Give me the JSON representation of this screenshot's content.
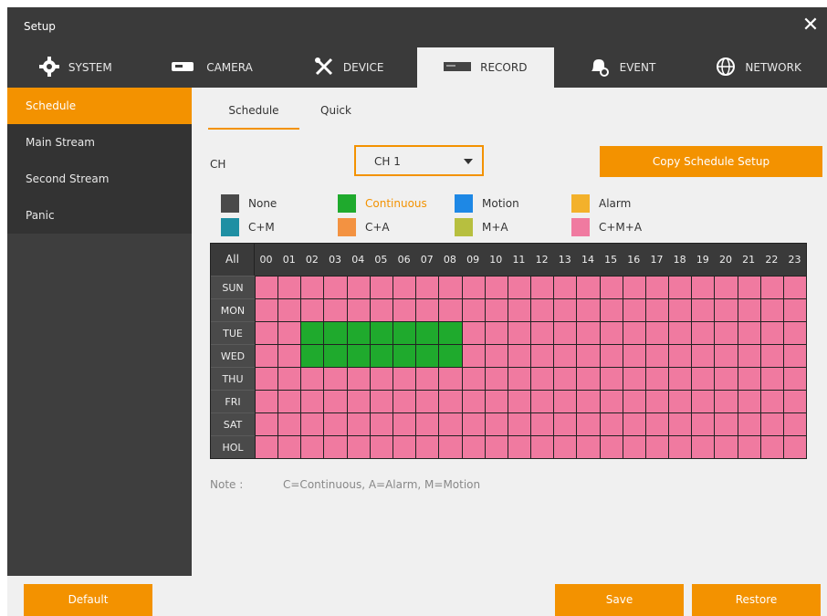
{
  "window": {
    "title": "Setup"
  },
  "tabs": [
    {
      "label": "SYSTEM",
      "icon": "gear-icon",
      "active": false
    },
    {
      "label": "CAMERA",
      "icon": "camera-icon",
      "active": false
    },
    {
      "label": "DEVICE",
      "icon": "tools-icon",
      "active": false
    },
    {
      "label": "RECORD",
      "icon": "recorder-icon",
      "active": true
    },
    {
      "label": "EVENT",
      "icon": "bell-icon",
      "active": false
    },
    {
      "label": "NETWORK",
      "icon": "globe-icon",
      "active": false
    }
  ],
  "sidebar": {
    "items": [
      {
        "label": "Schedule",
        "active": true
      },
      {
        "label": "Main Stream",
        "active": false
      },
      {
        "label": "Second Stream",
        "active": false
      },
      {
        "label": "Panic",
        "active": false
      }
    ]
  },
  "subtabs": [
    {
      "label": "Schedule",
      "active": true
    },
    {
      "label": "Quick",
      "active": false
    }
  ],
  "channel": {
    "label": "CH",
    "selected": "CH 1"
  },
  "copy_button": "Copy Schedule Setup",
  "legend": [
    {
      "label": "None",
      "color": "#4a4a4a"
    },
    {
      "label": "Continuous",
      "color": "#1faa2d"
    },
    {
      "label": "Motion",
      "color": "#1e88e5"
    },
    {
      "label": "Alarm",
      "color": "#f3b12b"
    },
    {
      "label": "C+M",
      "color": "#1f8fa3"
    },
    {
      "label": "C+A",
      "color": "#f39241"
    },
    {
      "label": "M+A",
      "color": "#b7bf3f"
    },
    {
      "label": "C+M+A",
      "color": "#f07aa0"
    }
  ],
  "schedule": {
    "all_label": "All",
    "hours": [
      "00",
      "01",
      "02",
      "03",
      "04",
      "05",
      "06",
      "07",
      "08",
      "09",
      "10",
      "11",
      "12",
      "13",
      "14",
      "15",
      "16",
      "17",
      "18",
      "19",
      "20",
      "21",
      "22",
      "23"
    ],
    "days": [
      "SUN",
      "MON",
      "TUE",
      "WED",
      "THU",
      "FRI",
      "SAT",
      "HOL"
    ],
    "modes": {
      "SUN": [
        "C+M+A",
        "C+M+A",
        "C+M+A",
        "C+M+A",
        "C+M+A",
        "C+M+A",
        "C+M+A",
        "C+M+A",
        "C+M+A",
        "C+M+A",
        "C+M+A",
        "C+M+A",
        "C+M+A",
        "C+M+A",
        "C+M+A",
        "C+M+A",
        "C+M+A",
        "C+M+A",
        "C+M+A",
        "C+M+A",
        "C+M+A",
        "C+M+A",
        "C+M+A",
        "C+M+A"
      ],
      "MON": [
        "C+M+A",
        "C+M+A",
        "C+M+A",
        "C+M+A",
        "C+M+A",
        "C+M+A",
        "C+M+A",
        "C+M+A",
        "C+M+A",
        "C+M+A",
        "C+M+A",
        "C+M+A",
        "C+M+A",
        "C+M+A",
        "C+M+A",
        "C+M+A",
        "C+M+A",
        "C+M+A",
        "C+M+A",
        "C+M+A",
        "C+M+A",
        "C+M+A",
        "C+M+A",
        "C+M+A"
      ],
      "TUE": [
        "C+M+A",
        "C+M+A",
        "Continuous",
        "Continuous",
        "Continuous",
        "Continuous",
        "Continuous",
        "Continuous",
        "Continuous",
        "C+M+A",
        "C+M+A",
        "C+M+A",
        "C+M+A",
        "C+M+A",
        "C+M+A",
        "C+M+A",
        "C+M+A",
        "C+M+A",
        "C+M+A",
        "C+M+A",
        "C+M+A",
        "C+M+A",
        "C+M+A",
        "C+M+A"
      ],
      "WED": [
        "C+M+A",
        "C+M+A",
        "Continuous",
        "Continuous",
        "Continuous",
        "Continuous",
        "Continuous",
        "Continuous",
        "Continuous",
        "C+M+A",
        "C+M+A",
        "C+M+A",
        "C+M+A",
        "C+M+A",
        "C+M+A",
        "C+M+A",
        "C+M+A",
        "C+M+A",
        "C+M+A",
        "C+M+A",
        "C+M+A",
        "C+M+A",
        "C+M+A",
        "C+M+A"
      ],
      "THU": [
        "C+M+A",
        "C+M+A",
        "C+M+A",
        "C+M+A",
        "C+M+A",
        "C+M+A",
        "C+M+A",
        "C+M+A",
        "C+M+A",
        "C+M+A",
        "C+M+A",
        "C+M+A",
        "C+M+A",
        "C+M+A",
        "C+M+A",
        "C+M+A",
        "C+M+A",
        "C+M+A",
        "C+M+A",
        "C+M+A",
        "C+M+A",
        "C+M+A",
        "C+M+A",
        "C+M+A"
      ],
      "FRI": [
        "C+M+A",
        "C+M+A",
        "C+M+A",
        "C+M+A",
        "C+M+A",
        "C+M+A",
        "C+M+A",
        "C+M+A",
        "C+M+A",
        "C+M+A",
        "C+M+A",
        "C+M+A",
        "C+M+A",
        "C+M+A",
        "C+M+A",
        "C+M+A",
        "C+M+A",
        "C+M+A",
        "C+M+A",
        "C+M+A",
        "C+M+A",
        "C+M+A",
        "C+M+A",
        "C+M+A"
      ],
      "SAT": [
        "C+M+A",
        "C+M+A",
        "C+M+A",
        "C+M+A",
        "C+M+A",
        "C+M+A",
        "C+M+A",
        "C+M+A",
        "C+M+A",
        "C+M+A",
        "C+M+A",
        "C+M+A",
        "C+M+A",
        "C+M+A",
        "C+M+A",
        "C+M+A",
        "C+M+A",
        "C+M+A",
        "C+M+A",
        "C+M+A",
        "C+M+A",
        "C+M+A",
        "C+M+A",
        "C+M+A"
      ],
      "HOL": [
        "C+M+A",
        "C+M+A",
        "C+M+A",
        "C+M+A",
        "C+M+A",
        "C+M+A",
        "C+M+A",
        "C+M+A",
        "C+M+A",
        "C+M+A",
        "C+M+A",
        "C+M+A",
        "C+M+A",
        "C+M+A",
        "C+M+A",
        "C+M+A",
        "C+M+A",
        "C+M+A",
        "C+M+A",
        "C+M+A",
        "C+M+A",
        "C+M+A",
        "C+M+A",
        "C+M+A"
      ]
    }
  },
  "note": {
    "label": "Note :",
    "text": "C=Continuous, A=Alarm, M=Motion"
  },
  "buttons": {
    "default": "Default",
    "save": "Save",
    "restore": "Restore"
  },
  "colors": {
    "accent": "#f39200",
    "dark": "#3a3a3a"
  }
}
